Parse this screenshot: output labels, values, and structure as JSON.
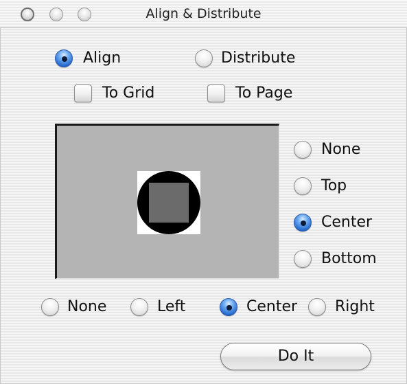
{
  "window": {
    "title": "Align & Distribute"
  },
  "mode": {
    "align_label": "Align",
    "distribute_label": "Distribute",
    "selected": "Align"
  },
  "options": {
    "to_grid_label": "To Grid",
    "to_grid_checked": false,
    "to_page_label": "To Page",
    "to_page_checked": false
  },
  "vertical": {
    "none_label": "None",
    "top_label": "Top",
    "center_label": "Center",
    "bottom_label": "Bottom",
    "selected": "Center"
  },
  "horizontal": {
    "none_label": "None",
    "left_label": "Left",
    "center_label": "Center",
    "right_label": "Right",
    "selected": "Center"
  },
  "actions": {
    "do_it_label": "Do It"
  },
  "colors": {
    "radio_selected": "#1f63c9",
    "preview_background": "#b4b4b4"
  }
}
